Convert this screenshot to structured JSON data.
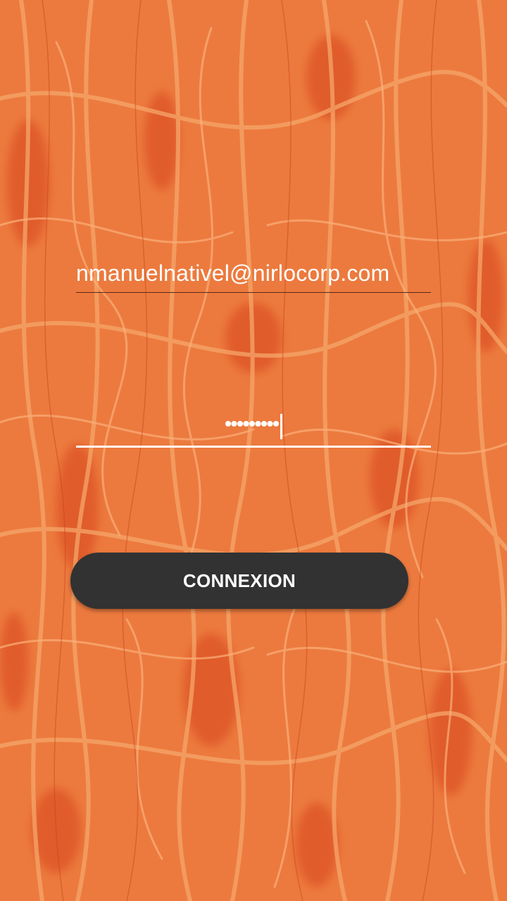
{
  "login_form": {
    "email_value": "nmanuelnativel@nirlocorp.com",
    "password_masked": "•••••••••",
    "submit_label": "CONNEXION"
  },
  "colors": {
    "background": "#ec7a3e",
    "texture_vein": "#f49a5e",
    "texture_dark": "#d8451f",
    "button": "#323232",
    "text": "#ffffff"
  }
}
